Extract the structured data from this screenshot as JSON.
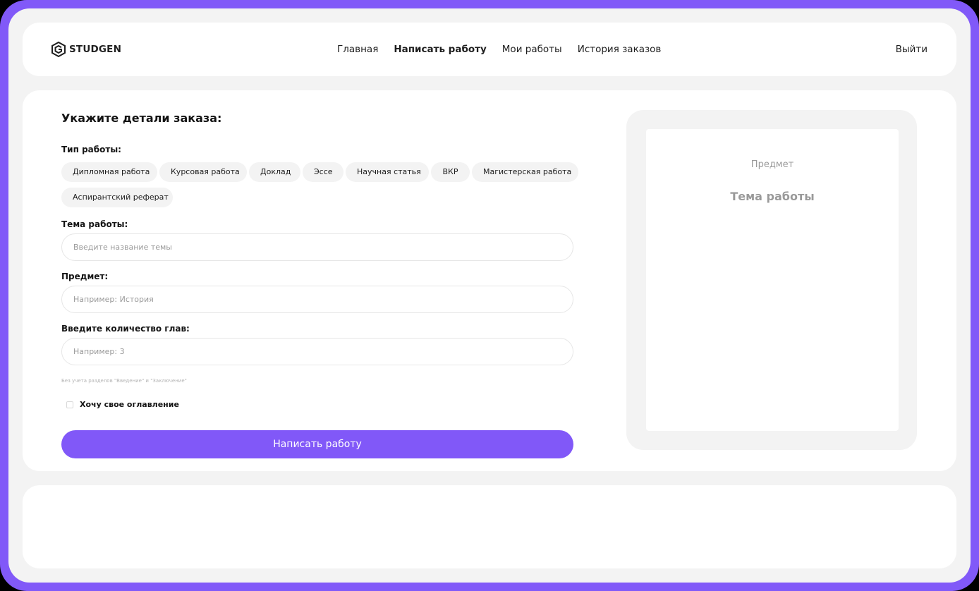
{
  "header": {
    "logo_text": "STUDGEN",
    "nav": [
      {
        "label": "Главная"
      },
      {
        "label": "Написать работу"
      },
      {
        "label": "Мои работы"
      },
      {
        "label": "История заказов"
      }
    ],
    "logout_label": "Выйти"
  },
  "form": {
    "title": "Укажите детали заказа:",
    "work_type_label": "Тип работы:",
    "work_types": [
      "Дипломная работа",
      "Курсовая работа",
      "Доклад",
      "Эссе",
      "Научная статья",
      "ВКР",
      "Магистерская работа",
      "Аспирантский реферат"
    ],
    "topic": {
      "label": "Тема работы:",
      "placeholder": "Введите название темы",
      "value": ""
    },
    "subject": {
      "label": "Предмет:",
      "placeholder": "Например: История",
      "value": ""
    },
    "chapters": {
      "label": "Введите количество глав:",
      "placeholder": "Например: 3",
      "value": "",
      "hint": "Без учета разделов \"Введение\" и \"Заключение\""
    },
    "custom_toc": {
      "label": "Хочу свое оглавление",
      "checked": false
    },
    "submit_label": "Написать работу"
  },
  "preview": {
    "subject": "Предмет",
    "topic": "Тема работы"
  },
  "colors": {
    "accent": "#8158F8",
    "frame": "#8159F8",
    "background": "#F3F3F3",
    "chip": "#F3F3F3"
  },
  "icons": {
    "logo": "studgen-logo-icon",
    "checkbox": "checkbox-icon"
  }
}
